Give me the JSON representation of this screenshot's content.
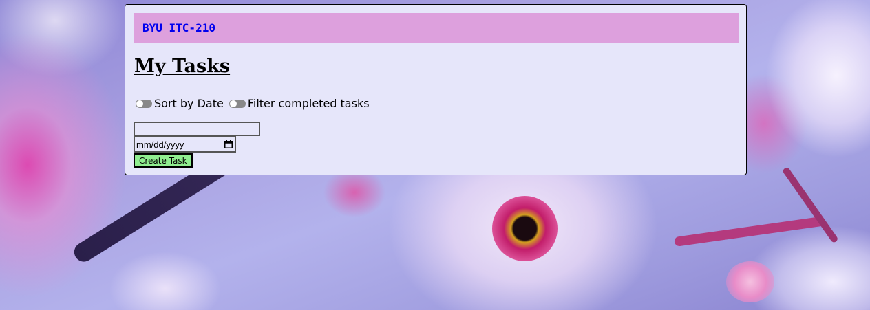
{
  "header": {
    "course_link": "BYU ITC-210"
  },
  "page": {
    "title": "My Tasks"
  },
  "toggles": [
    {
      "label": "Sort by Date",
      "checked": false
    },
    {
      "label": "Filter completed tasks",
      "checked": false
    }
  ],
  "form": {
    "task_value": "",
    "date_placeholder": "mm/dd/yyyy",
    "create_label": "Create Task"
  },
  "colors": {
    "panel_bg": "#e6e6fa",
    "header_bg": "#dda0dd",
    "link": "#0000ee",
    "button_bg": "#90ee90"
  }
}
